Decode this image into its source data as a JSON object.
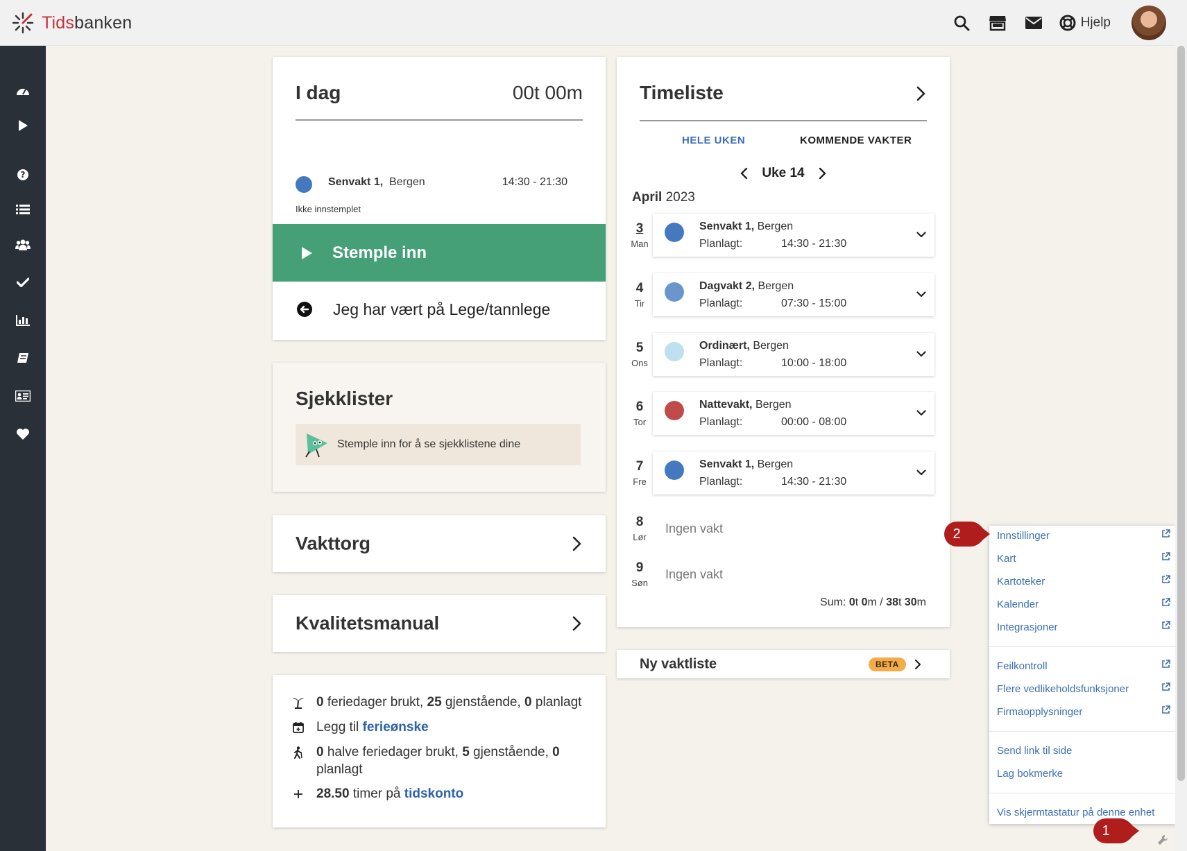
{
  "app": {
    "logo_prefix": "Tids",
    "logo_suffix": "banken",
    "help_label": "Hjelp"
  },
  "colors": {
    "accent": "#45a077",
    "sidebar": "#2a3038",
    "link": "#3b6fb3",
    "badge": "#b01d1d",
    "beta": "#f4ab4a"
  },
  "topbar_icons": [
    "search-icon",
    "store-icon",
    "mail-icon",
    "lifebuoy-icon",
    "avatar"
  ],
  "sidebar_icons": [
    "dashboard-icon",
    "play-icon",
    "question-icon",
    "list-icon",
    "users-icon",
    "check-icon",
    "chart-icon",
    "book-icon",
    "id-card-icon",
    "heart-icon"
  ],
  "today": {
    "title": "I dag",
    "time": "00t 00m",
    "shift_name": "Senvakt 1,",
    "shift_location": "Bergen",
    "shift_hours": "14:30 - 21:30",
    "status": "Ikke innstemplet",
    "stamp_in_label": "Stemple inn",
    "doctor_label": "Jeg har vært på Lege/tannlege"
  },
  "checklists": {
    "title": "Sjekklister",
    "message": "Stemple inn for å se sjekklistene dine"
  },
  "vakttorg": {
    "title": "Vakttorg"
  },
  "quality_manual": {
    "title": "Kvalitetsmanual"
  },
  "vacation": {
    "line1": {
      "used": "0",
      "used_text": " feriedager brukt, ",
      "remaining": "25",
      "remaining_text": " gjenstående, ",
      "planned": "0",
      "planned_text": " planlagt"
    },
    "line2": {
      "prefix": "Legg til ",
      "link": "ferieønske"
    },
    "line3": {
      "used": "0",
      "used_text": " halve feriedager brukt, ",
      "remaining": "5",
      "remaining_text": " gjenstående, ",
      "planned": "0",
      "planned_text": "planlagt"
    },
    "line4": {
      "hours": "28.50",
      "text": " timer på ",
      "link": "tidskonto"
    }
  },
  "timesheet": {
    "title": "Timeliste",
    "tab_week": "HELE UKEN",
    "tab_upcoming": "KOMMENDE VAKTER",
    "week_label": "Uke 14",
    "month": "April",
    "year": "2023",
    "planned_label": "Planlagt:",
    "days": [
      {
        "num": "3",
        "name": "Man",
        "shift": "Senvakt 1,",
        "location": "Bergen",
        "time": "14:30 - 21:30",
        "color": "#4479c0"
      },
      {
        "num": "4",
        "name": "Tir",
        "shift": "Dagvakt 2,",
        "location": "Bergen",
        "time": "07:30 - 15:00",
        "color": "#6b96cc"
      },
      {
        "num": "5",
        "name": "Ons",
        "shift": "Ordinært,",
        "location": "Bergen",
        "time": "10:00 - 18:00",
        "color": "#bfe0f0"
      },
      {
        "num": "6",
        "name": "Tor",
        "shift": "Nattevakt,",
        "location": "Bergen",
        "time": "00:00 - 08:00",
        "color": "#c14a4a"
      },
      {
        "num": "7",
        "name": "Fre",
        "shift": "Senvakt 1,",
        "location": "Bergen",
        "time": "14:30 - 21:30",
        "color": "#4479c0"
      }
    ],
    "empty_days": [
      {
        "num": "8",
        "name": "Lør",
        "label": "Ingen vakt"
      },
      {
        "num": "9",
        "name": "Søn",
        "label": "Ingen vakt"
      }
    ],
    "sum": {
      "label": "Sum: ",
      "h1": "0",
      "u1": "t ",
      "m1": "0",
      "u2": "m / ",
      "h2": "38",
      "u3": "t ",
      "m2": "30",
      "u4": "m"
    }
  },
  "new_roster": {
    "title": "Ny vaktliste",
    "badge": "BETA"
  },
  "menu": {
    "group1": [
      "Innstillinger",
      "Kart",
      "Kartoteker",
      "Kalender",
      "Integrasjoner"
    ],
    "group2": [
      "Feilkontroll",
      "Flere vedlikeholdsfunksjoner",
      "Firmaopplysninger"
    ],
    "group3": [
      "Send link til side",
      "Lag bokmerke"
    ],
    "group4": [
      "Vis skjermtastatur på denne enhet"
    ]
  },
  "callouts": {
    "one": "1",
    "two": "2"
  }
}
